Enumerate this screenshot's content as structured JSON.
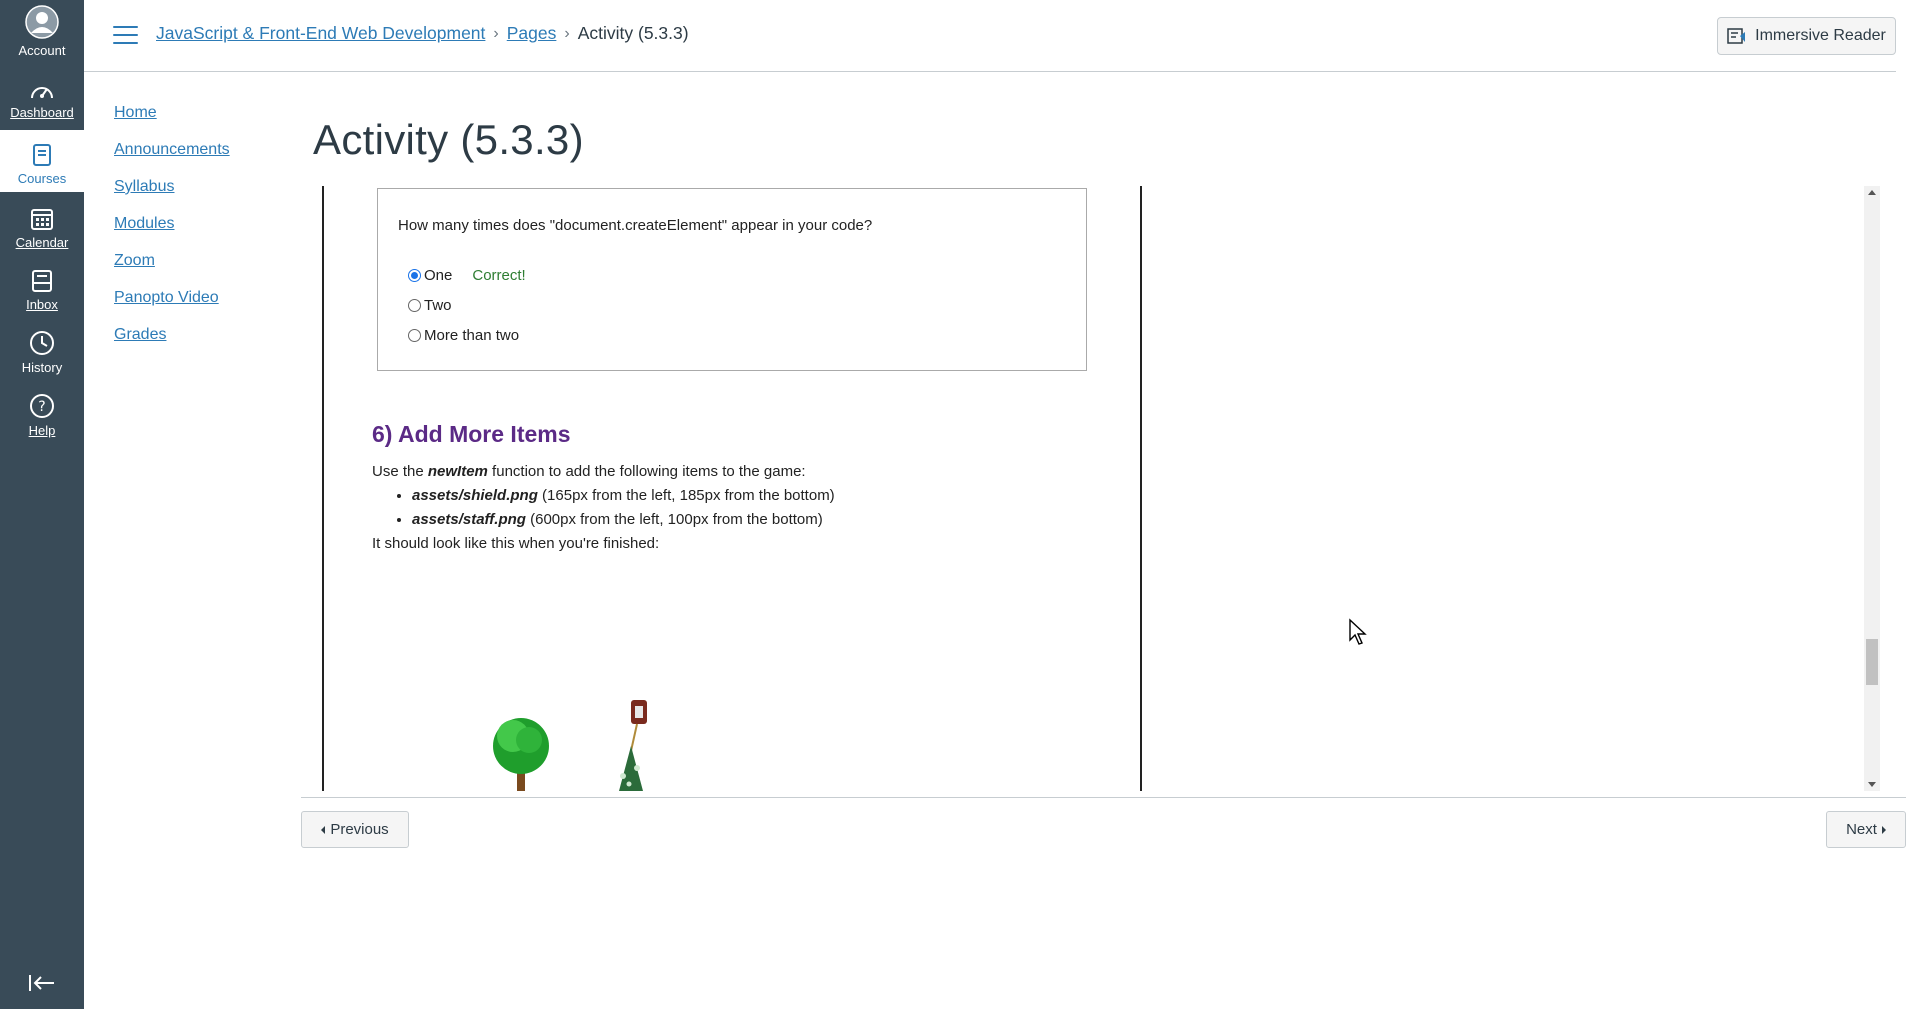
{
  "global_nav": {
    "account": "Account",
    "dashboard": "Dashboard",
    "courses": "Courses",
    "calendar": "Calendar",
    "inbox": "Inbox",
    "history": "History",
    "help": "Help"
  },
  "breadcrumb": {
    "course": "JavaScript & Front-End Web Development",
    "pages": "Pages",
    "current": "Activity (5.3.3)"
  },
  "header": {
    "immersive_reader": "Immersive Reader"
  },
  "course_nav": [
    "Home",
    "Announcements",
    "Syllabus",
    "Modules",
    "Zoom",
    "Panopto Video",
    "Grades"
  ],
  "page_title": "Activity (5.3.3)",
  "quiz": {
    "question": "How many times does \"document.createElement\" appear in your code?",
    "options": [
      "One",
      "Two",
      "More than two"
    ],
    "selected": "One",
    "feedback": "Correct!"
  },
  "section": {
    "title": "6) Add More Items",
    "intro_prefix": "Use the ",
    "intro_fn": "newItem",
    "intro_suffix": " function to add the following items to the game:",
    "items": [
      {
        "file": "assets/shield.png",
        "detail": " (165px from the left, 185px from the bottom)"
      },
      {
        "file": "assets/staff.png",
        "detail": " (600px from the left, 100px from the bottom)"
      }
    ],
    "outro": "It should look like this when you're finished:"
  },
  "pager": {
    "previous": "Previous",
    "next": "Next"
  },
  "colors": {
    "nav_bg": "#394b58",
    "link": "#2d7bb6",
    "section_title": "#5b2a86",
    "correct": "#2e7d32"
  }
}
